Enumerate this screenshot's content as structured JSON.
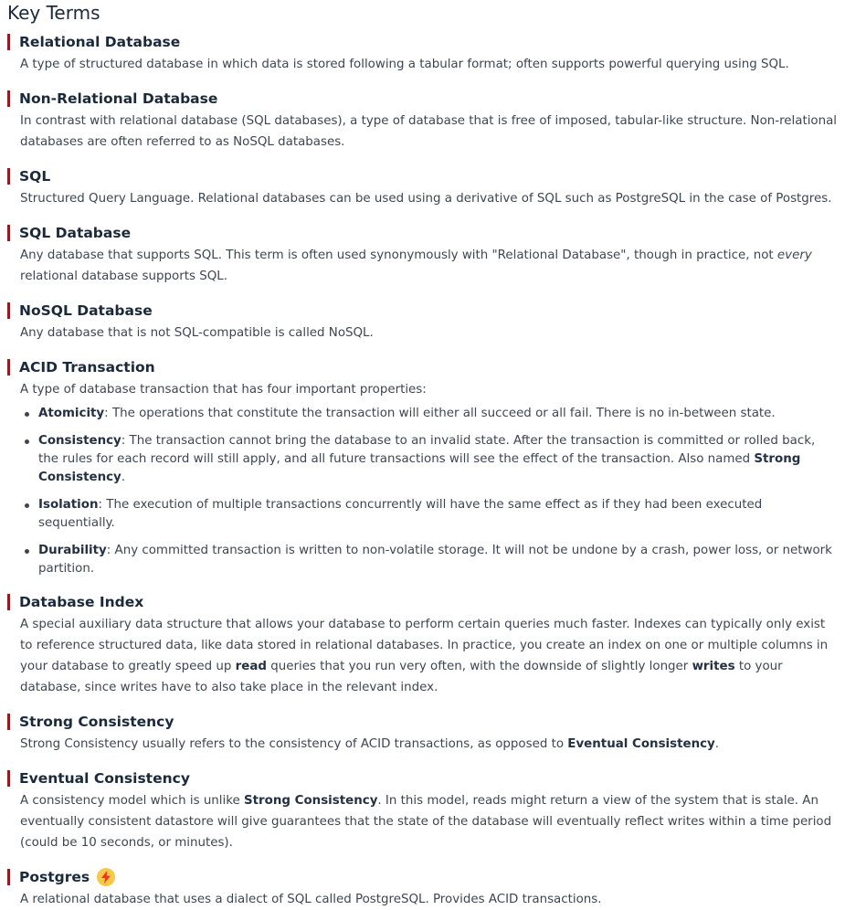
{
  "title": "Key Terms",
  "terms": [
    {
      "title": "Relational Database",
      "desc": [
        "A type of structured database in which data is stored following a tabular format; often supports powerful querying using SQL."
      ]
    },
    {
      "title": "Non-Relational Database",
      "desc": [
        "In contrast with relational database (SQL databases), a type of database that is free of imposed, tabular-like structure. Non-relational databases are often referred to as NoSQL databases."
      ]
    },
    {
      "title": "SQL",
      "desc": [
        "Structured Query Language. Relational databases can be used using a derivative of SQL such as PostgreSQL in the case of Postgres."
      ]
    },
    {
      "title": "SQL Database",
      "desc": [
        "Any database that supports SQL. This term is often used synonymously with \"Relational Database\", though in practice, not ",
        "every",
        " relational database supports SQL."
      ]
    },
    {
      "title": "NoSQL Database",
      "desc": [
        "Any database that is not SQL-compatible is called NoSQL."
      ]
    },
    {
      "title": "ACID Transaction",
      "desc": [
        "A type of database transaction that has four important properties:"
      ],
      "properties": [
        {
          "name": "Atomicity",
          "text": ": The operations that constitute the transaction will either all succeed or all fail. There is no in-between state."
        },
        {
          "name": "Consistency",
          "text": ": The transaction cannot bring the database to an invalid state. After the transaction is committed or rolled back, the rules for each record will still apply, and all future transactions will see the effect of the transaction. Also named ",
          "strong": "Strong Consistency",
          "tail": "."
        },
        {
          "name": "Isolation",
          "text": ": The execution of multiple transactions concurrently will have the same effect as if they had been executed sequentially."
        },
        {
          "name": "Durability",
          "text": ": Any committed transaction is written to non-volatile storage. It will not be undone by a crash, power loss, or network partition."
        }
      ]
    },
    {
      "title": "Database Index",
      "desc": [
        "A special auxiliary data structure that allows your database to perform certain queries much faster. Indexes can typically only exist to reference structured data, like data stored in relational databases. In practice, you create an index on one or multiple columns in your database to greatly speed up ",
        "read",
        " queries that you run very often, with the downside of slightly longer ",
        "writes",
        " to your database, since writes have to also take place in the relevant index."
      ]
    },
    {
      "title": "Strong Consistency",
      "desc": [
        "Strong Consistency usually refers to the consistency of ACID transactions, as opposed to ",
        "Eventual Consistency",
        "."
      ]
    },
    {
      "title": "Eventual Consistency",
      "desc": [
        "A consistency model which is unlike ",
        "Strong Consistency",
        ". In this model, reads might return a view of the system that is stale. An eventually consistent datastore will give guarantees that the state of the database will eventually reflect writes within a time period (could be 10 seconds, or minutes)."
      ]
    },
    {
      "title": "Postgres",
      "icon": "lightning-bolt-icon",
      "desc": [
        "A relational database that uses a dialect of SQL called PostgreSQL. Provides ACID transactions."
      ]
    }
  ],
  "colors": {
    "accent_bar": "#8e1c23",
    "heading": "#1b2a3a",
    "body_text": "#3d4650",
    "bolt_badge": "#f7c948",
    "bolt": "#e8361f"
  }
}
